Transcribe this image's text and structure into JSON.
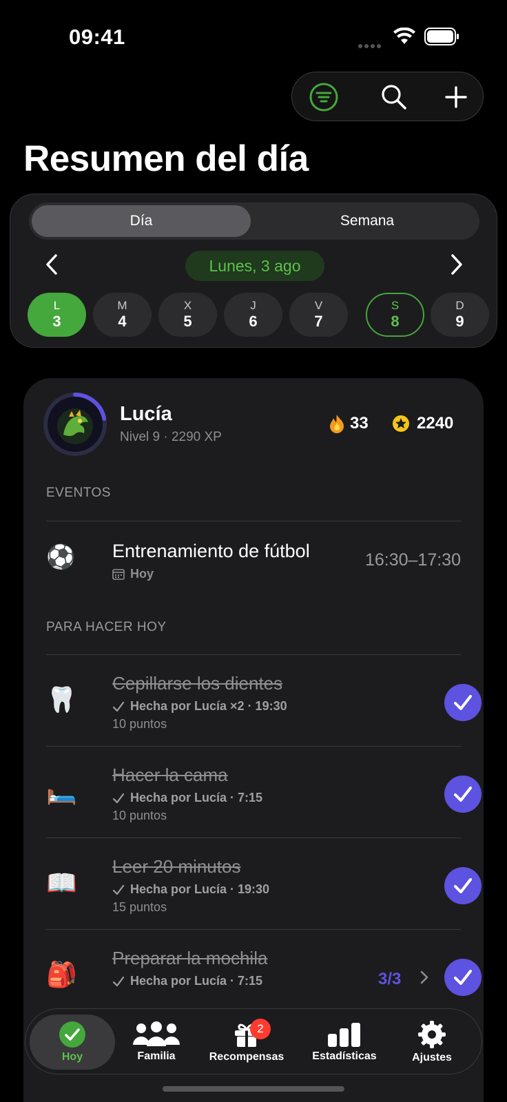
{
  "status_bar": {
    "time": "09:41"
  },
  "page": {
    "title": "Resumen del día"
  },
  "calendar": {
    "segments": {
      "day": "Día",
      "week": "Semana"
    },
    "current_date": "Lunes, 3 ago",
    "days": [
      {
        "letter": "L",
        "number": "3"
      },
      {
        "letter": "M",
        "number": "4"
      },
      {
        "letter": "X",
        "number": "5"
      },
      {
        "letter": "J",
        "number": "6"
      },
      {
        "letter": "V",
        "number": "7"
      },
      {
        "letter": "S",
        "number": "8"
      },
      {
        "letter": "D",
        "number": "9"
      }
    ]
  },
  "profile": {
    "name": "Lucía",
    "level": "Nivel 9 · 2290 XP",
    "streak": "33",
    "coins": "2240",
    "level_progress": 0.22
  },
  "events": {
    "heading": "EVENTOS",
    "items": [
      {
        "icon": "⚽",
        "title": "Entrenamiento de fútbol",
        "sub": "Hoy",
        "time": "16:30–17:30"
      }
    ]
  },
  "tasks": {
    "heading": "PARA HACER HOY",
    "items": [
      {
        "icon": "🦷",
        "title": "Cepillarse los dientes",
        "done": "Hecha por Lucía ×2 · 19:30",
        "points": "10 puntos"
      },
      {
        "icon": "🛏️",
        "title": "Hacer la cama",
        "done": "Hecha por Lucía · 7:15",
        "points": "10 puntos"
      },
      {
        "icon": "📖",
        "title": "Leer 20 minutos",
        "done": "Hecha por Lucía · 19:30",
        "points": "15 puntos"
      },
      {
        "icon": "🎒",
        "title": "Preparar la mochila",
        "done": "Hecha por Lucía · 7:15",
        "points": "",
        "count": "3/3"
      }
    ]
  },
  "tab_bar": {
    "items": [
      {
        "label": "Hoy"
      },
      {
        "label": "Familia"
      },
      {
        "label": "Recompensas",
        "badge": "2"
      },
      {
        "label": "Estadísticas"
      },
      {
        "label": "Ajustes"
      }
    ]
  },
  "colors": {
    "accent_green": "#44a83c",
    "accent_purple": "#5e52e0",
    "badge_red": "#ff3b30"
  }
}
